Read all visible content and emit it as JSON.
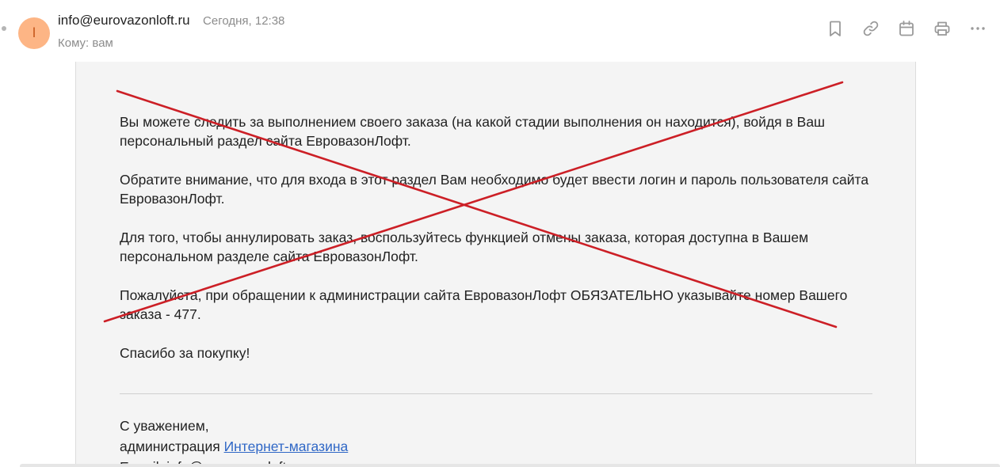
{
  "header": {
    "avatar_letter": "I",
    "sender": "info@eurovazonloft.ru",
    "date": "Сегодня, 12:38",
    "recipient": "Кому: вам"
  },
  "toolbar": {
    "icons": [
      "bookmark-icon",
      "link-icon",
      "calendar-icon",
      "print-icon",
      "more-icon"
    ]
  },
  "body": {
    "paragraphs": [
      "Вы можете следить за выполнением своего заказа (на какой стадии выполнения он находится), войдя в Ваш персональный раздел сайта ЕвровазонЛофт.",
      "Обратите внимание, что для входа в этот раздел Вам необходимо будет ввести логин и пароль пользователя сайта ЕвровазонЛофт.",
      "Для того, чтобы аннулировать заказ, воспользуйтесь функцией отмены заказа, которая доступна в Вашем персональном разделе сайта ЕвровазонЛофт.",
      "Пожалуйста, при обращении к администрации сайта ЕвровазонЛофт ОБЯЗАТЕЛЬНО указывайте номер Вашего заказа - 477.",
      "Спасибо за покупку!"
    ]
  },
  "signature": {
    "regards": "С уважением,",
    "admin_prefix": "администрация ",
    "shop_link": "Интернет-магазина",
    "email_line": "E-mail: info@eurovazonloft.ru"
  },
  "colors": {
    "cross": "#cc1f26",
    "link": "#2f67c6",
    "avatar_bg": "#fdb585"
  }
}
